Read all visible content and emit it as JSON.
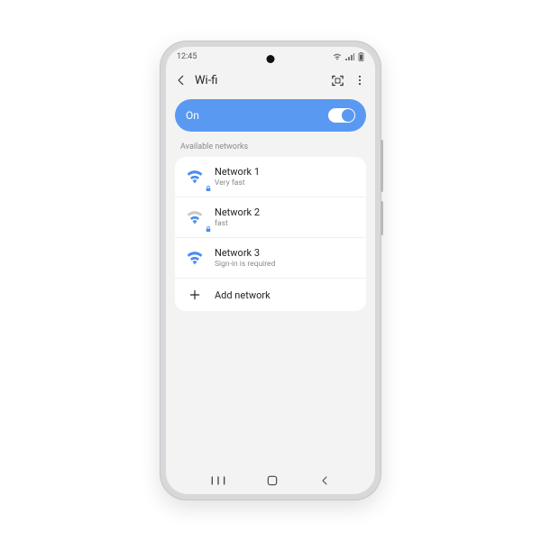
{
  "status": {
    "time": "12:45"
  },
  "header": {
    "title": "Wi-fi"
  },
  "toggle": {
    "label": "On"
  },
  "section": {
    "available_label": "Available networks"
  },
  "networks": [
    {
      "name": "Network 1",
      "sub": "Very fast"
    },
    {
      "name": "Network 2",
      "sub": "fast"
    },
    {
      "name": "Network 3",
      "sub": "Sign-in is required"
    }
  ],
  "add": {
    "label": "Add network"
  }
}
